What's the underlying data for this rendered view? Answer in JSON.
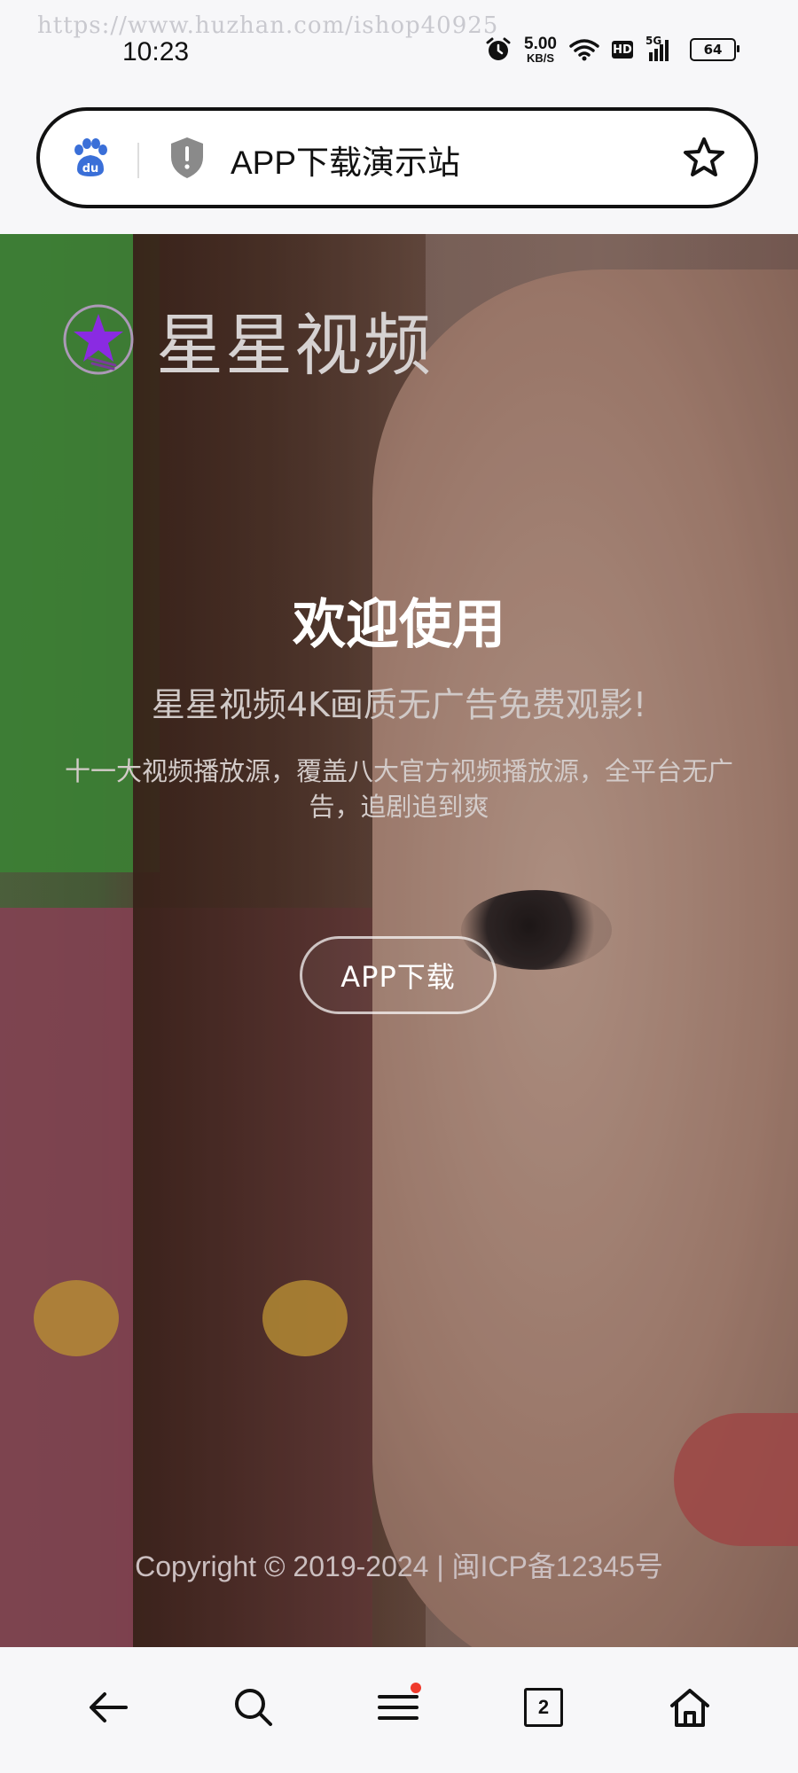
{
  "status_bar": {
    "watermark": "https://www.huzhan.com/ishop40925",
    "time": "10:23",
    "net_speed_value": "5.00",
    "net_speed_unit": "KB/S",
    "hd_label": "HD",
    "signal_label": "5G",
    "battery_level": "64",
    "icons": [
      "alarm-icon",
      "wifi-icon",
      "hd-icon",
      "signal-5g-icon",
      "battery-icon"
    ]
  },
  "browser": {
    "url_text": "APP下载演示站",
    "icons": [
      "baidu-paw-icon",
      "security-shield-icon",
      "star-bookmark-icon"
    ]
  },
  "page": {
    "brand_name": "星星视频",
    "welcome": "欢迎使用",
    "tagline": "星星视频4K画质无广告免费观影!",
    "description": "十一大视频播放源，覆盖八大官方视频播放源，全平台无广告，追剧追到爽",
    "download_label": "APP下载",
    "copyright": "Copyright  ©  2019-2024  |  闽ICP备12345号"
  },
  "bottom_nav": {
    "tabs_count": "2",
    "icons": [
      "back-arrow-icon",
      "search-icon",
      "menu-icon",
      "tabs-icon",
      "home-icon"
    ]
  },
  "colors": {
    "accent_dot": "#ef3b2d",
    "brand_logo": "#8a2be2"
  }
}
